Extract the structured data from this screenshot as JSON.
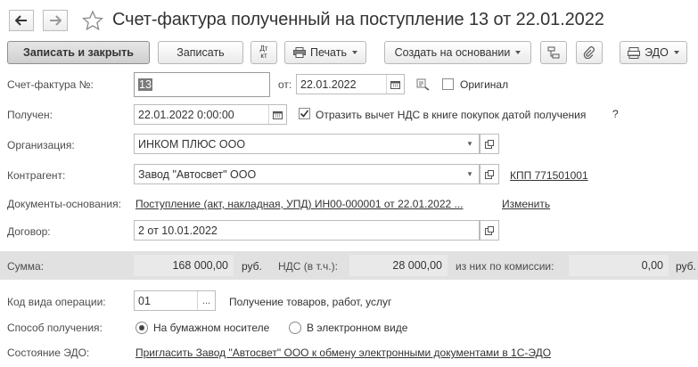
{
  "window": {
    "title": "Счет-фактура полученный на поступление 13 от 22.01.2022"
  },
  "toolbar": {
    "save_close": "Записать и закрыть",
    "save": "Записать",
    "dt_top": "Дт",
    "dt_bottom": "кт",
    "print": "Печать",
    "create_based": "Создать на основании",
    "edo": "ЭДО"
  },
  "form": {
    "invoice_label": "Счет-фактура №:",
    "invoice_number": "13",
    "from_label": "от:",
    "invoice_date": "22.01.2022",
    "original_label": "Оригинал",
    "original_checked": false,
    "received_label": "Получен:",
    "received_date": "22.01.2022  0:00:00",
    "vat_reflect_label": "Отразить вычет НДС в книге покупок датой получения",
    "vat_reflect_checked": true,
    "help_mark": "?",
    "org_label": "Организация:",
    "org_value": "ИНКОМ ПЛЮС ООО",
    "counterparty_label": "Контрагент:",
    "counterparty_value": "Завод \"Автосвет\" ООО",
    "kpp_link": "КПП 771501001",
    "base_docs_label": "Документы-основания:",
    "base_docs_link": "Поступление (акт, накладная, УПД) ИН00-000001 от 22.01.2022 ...",
    "change_link": "Изменить",
    "contract_label": "Договор:",
    "contract_value": "2 от 10.01.2022"
  },
  "summary": {
    "sum_label": "Сумма:",
    "sum_value": "168 000,00",
    "sum_currency": "руб.",
    "vat_label": "НДС (в т.ч.):",
    "vat_value": "28 000,00",
    "commission_label": "из них по комиссии:",
    "commission_value": "0,00",
    "commission_currency": "руб."
  },
  "operation": {
    "code_label": "Код вида операции:",
    "code_value": "01",
    "code_button": "...",
    "code_description": "Получение товаров, работ, услуг",
    "method_label": "Способ получения:",
    "method_paper": "На бумажном носителе",
    "method_electronic": "В электронном виде",
    "method_selected": "paper",
    "edo_state_label": "Состояние ЭДО:",
    "edo_state_link": "Пригласить Завод \"Автосвет\" ООО к обмену электронными документами в 1С-ЭДО"
  },
  "colors": {
    "summary_bar": "#e1e1e1",
    "primary_button": "#d6d6d6"
  }
}
